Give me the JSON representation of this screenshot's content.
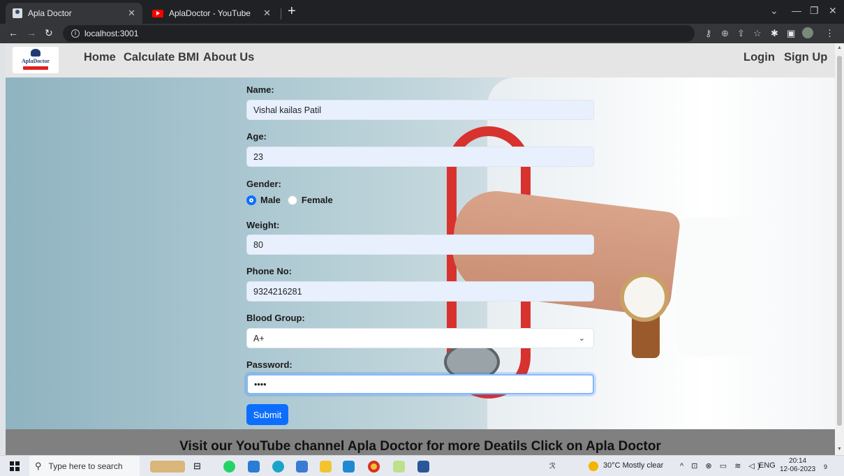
{
  "browser": {
    "tabs": [
      {
        "title": "Apla Doctor",
        "favicon": "doctor-logo-icon",
        "active": true
      },
      {
        "title": "AplaDoctor - YouTube",
        "favicon": "youtube-icon",
        "active": false
      }
    ],
    "url": "localhost:3001"
  },
  "navbar": {
    "logo_text": "AplaDoctor",
    "links": [
      "Home",
      "Calculate BMI",
      "About Us"
    ],
    "auth": [
      "Login",
      "Sign Up"
    ]
  },
  "form": {
    "name_label": "Name:",
    "name_value": "Vishal kailas Patil",
    "age_label": "Age:",
    "age_value": "23",
    "gender_label": "Gender:",
    "gender_options": [
      "Male",
      "Female"
    ],
    "gender_selected": "Male",
    "weight_label": "Weight:",
    "weight_value": "80",
    "phone_label": "Phone No:",
    "phone_value": "9324216281",
    "blood_label": "Blood Group:",
    "blood_value": "A+",
    "password_label": "Password:",
    "password_value": "••••",
    "submit_label": "Submit"
  },
  "footer": {
    "text": "Visit our YouTube channel Apla Doctor for more Deatils Click on Apla Doctor"
  },
  "taskbar": {
    "search_placeholder": "Type here to search",
    "weather": "30°C  Mostly clear",
    "language": "ENG",
    "time": "20:14",
    "date": "12-06-2023",
    "notification_count": "9"
  },
  "colors": {
    "primary": "#0d6efd",
    "navbar_bg": "#e5e5e5",
    "footer_bg": "#808080",
    "input_autofill": "#e8f0fe"
  }
}
